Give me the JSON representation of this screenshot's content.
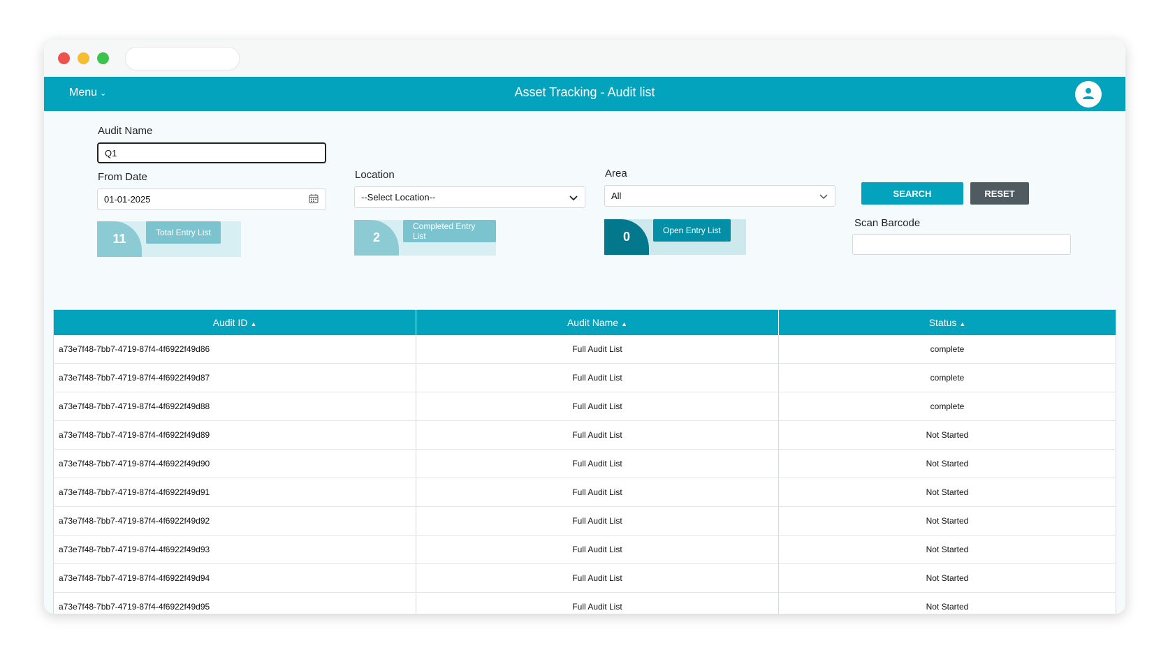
{
  "header": {
    "menu_label": "Menu",
    "title": "Asset Tracking - Audit list",
    "icons": {
      "menu_chevron": "chevron-down-icon",
      "profile": "user-icon"
    }
  },
  "filters": {
    "audit_name": {
      "label": "Audit Name",
      "value": "Q1"
    },
    "from_date": {
      "label": "From Date",
      "value": "01-01-2025",
      "icon": "calendar-icon"
    },
    "location": {
      "label": "Location",
      "value": "--Select Location--",
      "icon": "chevron-down-icon"
    },
    "area": {
      "label": "Area",
      "value": "All",
      "icon": "chevron-down-icon"
    },
    "search_label": "SEARCH",
    "reset_label": "RESET",
    "scan_barcode": {
      "label": "Scan Barcode",
      "value": ""
    }
  },
  "stats": {
    "total": {
      "count": "11",
      "label": "Total Entry List"
    },
    "completed": {
      "count": "2",
      "label": "Completed Entry List"
    },
    "open": {
      "count": "0",
      "label": "Open Entry List"
    }
  },
  "table": {
    "columns": [
      "Audit ID",
      "Audit Name",
      "Status"
    ],
    "rows": [
      {
        "id": "a73e7f48-7bb7-4719-87f4-4f6922f49d86",
        "name": "Full Audit List",
        "status": "complete"
      },
      {
        "id": "a73e7f48-7bb7-4719-87f4-4f6922f49d87",
        "name": "Full Audit List",
        "status": "complete"
      },
      {
        "id": "a73e7f48-7bb7-4719-87f4-4f6922f49d88",
        "name": "Full Audit List",
        "status": "complete"
      },
      {
        "id": "a73e7f48-7bb7-4719-87f4-4f6922f49d89",
        "name": "Full Audit List",
        "status": "Not Started"
      },
      {
        "id": "a73e7f48-7bb7-4719-87f4-4f6922f49d90",
        "name": "Full Audit List",
        "status": "Not Started"
      },
      {
        "id": "a73e7f48-7bb7-4719-87f4-4f6922f49d91",
        "name": "Full Audit List",
        "status": "Not Started"
      },
      {
        "id": "a73e7f48-7bb7-4719-87f4-4f6922f49d92",
        "name": "Full Audit List",
        "status": "Not Started"
      },
      {
        "id": "a73e7f48-7bb7-4719-87f4-4f6922f49d93",
        "name": "Full Audit List",
        "status": "Not Started"
      },
      {
        "id": "a73e7f48-7bb7-4719-87f4-4f6922f49d94",
        "name": "Full Audit List",
        "status": "Not Started"
      },
      {
        "id": "a73e7f48-7bb7-4719-87f4-4f6922f49d95",
        "name": "Full Audit List",
        "status": "Not Started"
      }
    ]
  },
  "colors": {
    "accent": "#03a3bd",
    "dark_accent": "#03778c",
    "reset": "#505a61"
  }
}
